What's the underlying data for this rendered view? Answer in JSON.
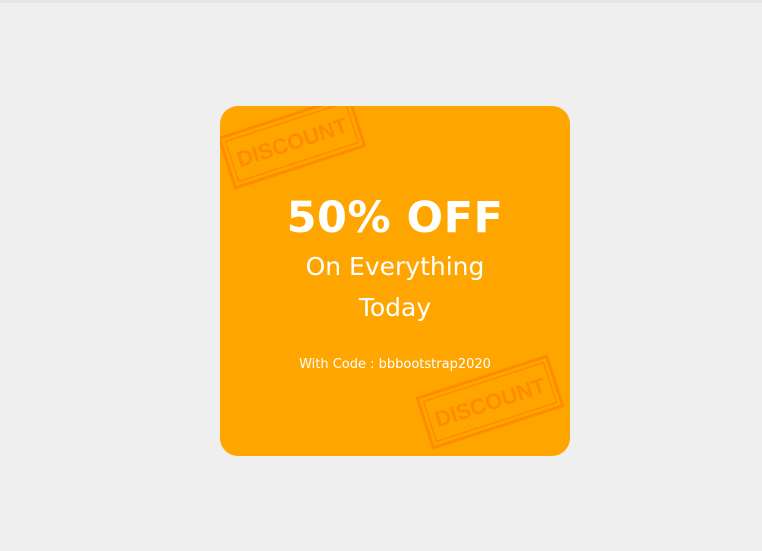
{
  "coupon": {
    "headline": "50% OFF",
    "subline_1": "On Everything",
    "subline_2": "Today",
    "code_text": "With Code : bbbootstrap2020",
    "stamp_text": "DISCOUNT",
    "colors": {
      "page_background": "#efefef",
      "card_background": "#ffa500",
      "stamp": "#ff8c00",
      "text": "#ffffff"
    }
  }
}
